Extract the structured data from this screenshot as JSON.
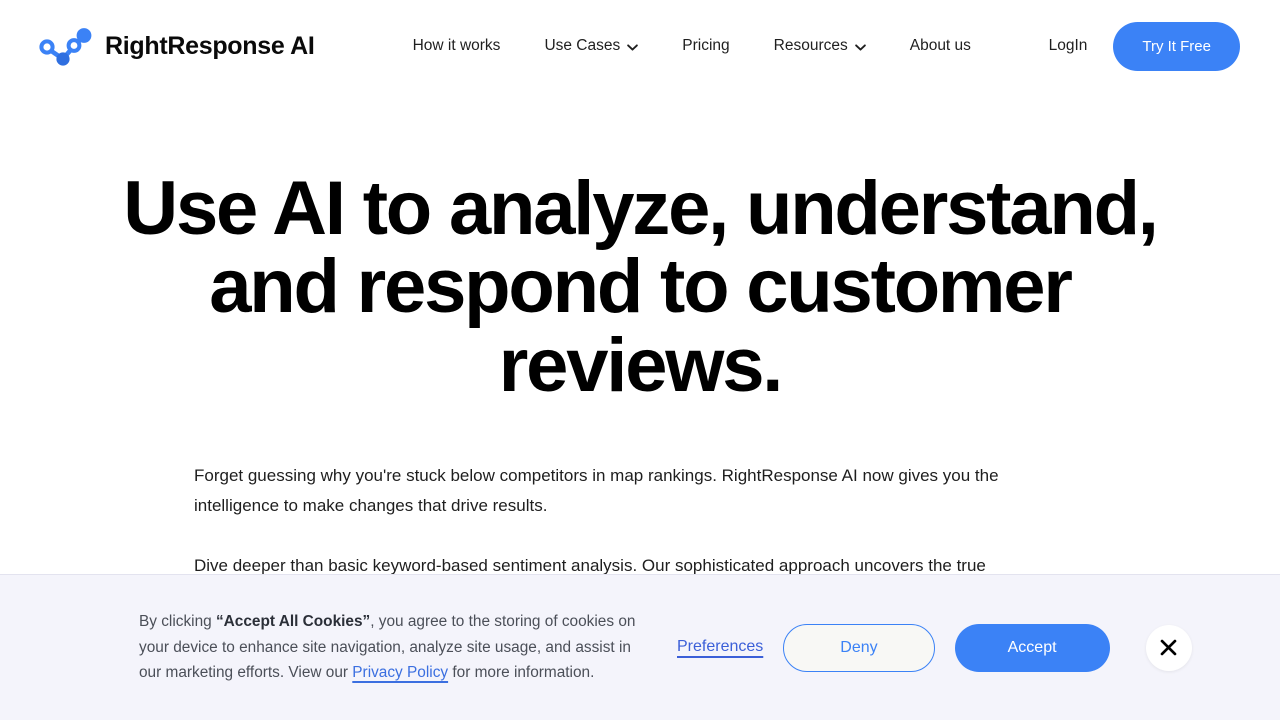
{
  "header": {
    "brand": {
      "name": "RightResponse AI",
      "logo_icon": "connected-nodes-graph-icon"
    },
    "nav_items": [
      {
        "label": "How it works",
        "has_dropdown": false
      },
      {
        "label": "Use Cases",
        "has_dropdown": true,
        "dropdown_icon": "chevron-down-icon"
      },
      {
        "label": "Pricing",
        "has_dropdown": false
      },
      {
        "label": "Resources",
        "has_dropdown": true,
        "dropdown_icon": "chevron-down-icon"
      },
      {
        "label": "About us",
        "has_dropdown": false
      }
    ],
    "login_label": "LogIn",
    "cta_label": "Try It Free"
  },
  "hero": {
    "title": "Use AI to analyze, understand, and respond to customer reviews.",
    "paragraphs": [
      "Forget guessing why you're stuck below competitors in map rankings. RightResponse AI now gives you the intelligence to make changes that drive results.",
      "Dive deeper than basic keyword-based sentiment analysis. Our sophisticated approach uncovers the true"
    ]
  },
  "cookie_banner": {
    "text_prefix": "By clicking ",
    "text_bold": "“Accept All Cookies”",
    "text_middle": ", you agree to the storing of cookies on your device to enhance site navigation, analyze site usage, and assist in our marketing efforts. View our ",
    "privacy_link_label": "Privacy Policy",
    "text_suffix": " for more information.",
    "preferences_label": "Preferences",
    "deny_label": "Deny",
    "accept_label": "Accept",
    "close_icon": "close-x-icon"
  },
  "colors": {
    "accent_blue": "#3b82f6",
    "link_blue": "#3b5fd8",
    "banner_background": "#f4f4fb",
    "deny_fill": "#f8f8f5",
    "heading_black": "#000000"
  }
}
